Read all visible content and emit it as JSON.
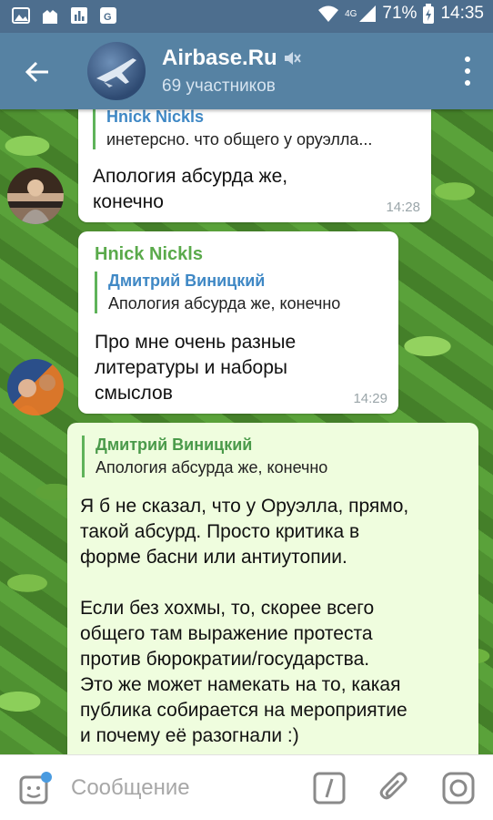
{
  "status_bar": {
    "battery": "71%",
    "time": "14:35",
    "network": "4G"
  },
  "header": {
    "title": "Airbase.Ru",
    "subtitle": "69 участников"
  },
  "messages": [
    {
      "reply_name": "Hnick Nickls",
      "reply_text": "инетерсно. что общего у оруэлла...",
      "text_line1": "Апология абсурда же,",
      "text_line2": "конечно",
      "time": "14:28"
    },
    {
      "sender": "Hnick Nickls",
      "reply_name": "Дмитрий Виницкий",
      "reply_text": "Апология абсурда же, конечно",
      "text_line1": "Про мне очень разные",
      "text_line2": "литературы и наборы",
      "text_line3": "смыслов",
      "time": "14:29"
    },
    {
      "reply_name": "Дмитрий Виницкий",
      "reply_text": "Апология абсурда же, конечно",
      "lines": [
        "Я б не сказал, что у Оруэлла, прямо,",
        "такой абсурд. Просто критика в",
        "форме басни или антиутопии.",
        "",
        "Если без хохмы, то, скорее всего",
        "общего там выражение протеста",
        "против бюрократии/государства.",
        "Это же может намекать на то, какая",
        "публика собирается на мероприятие",
        "и почему её разогнали :)"
      ]
    }
  ],
  "input": {
    "placeholder": "Сообщение"
  },
  "colors": {
    "header": "#5682a3",
    "status_bar": "#4d6e8e",
    "incoming_bubble": "#ffffff",
    "outgoing_bubble": "#effdde",
    "sender_name": "#5aaa4b",
    "reply_name_blue": "#3f88c5"
  },
  "icons": {
    "back": "arrow-left-icon",
    "mute": "muted-speaker-icon",
    "menu": "more-vertical-icon",
    "emoji": "sticker-icon",
    "command": "slash-command-icon",
    "attach": "paperclip-icon",
    "camera": "camera-icon"
  }
}
